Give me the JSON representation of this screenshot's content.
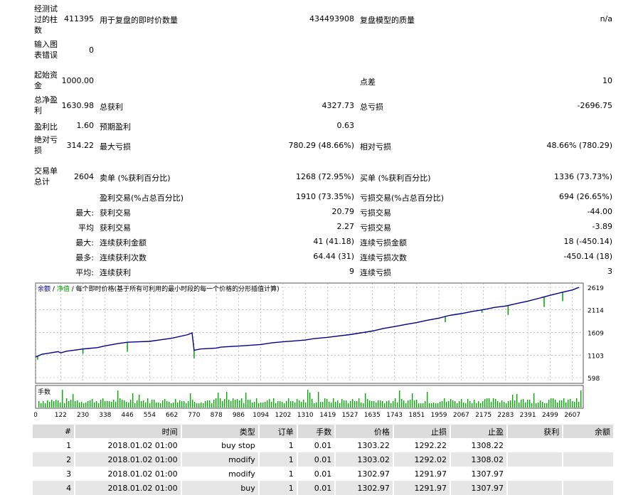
{
  "summary": {
    "bars_label": "经测试过的柱数",
    "bars_value": "411395",
    "ticks_label": "用于复盘的即时价数量",
    "ticks_value": "434493908",
    "quality_label": "复盘模型的质量",
    "quality_value": "n/a",
    "errors_label": "输入图表错误",
    "errors_value": "0",
    "deposit_label": "起始资金",
    "deposit_value": "1000.00",
    "spread_label": "点差",
    "spread_value": "10",
    "net_profit_label": "总净盈利",
    "net_profit_value": "1630.98",
    "gross_profit_label": "总获利",
    "gross_profit_value": "4327.73",
    "gross_loss_label": "总亏损",
    "gross_loss_value": "-2696.75",
    "profit_factor_label": "盈利比",
    "profit_factor_value": "1.60",
    "expected_payoff_label": "预期盈利",
    "expected_payoff_value": "0.63",
    "abs_drawdown_label": "绝对亏损",
    "abs_drawdown_value": "314.22",
    "max_drawdown_label": "最大亏损",
    "max_drawdown_value": "780.29 (48.66%)",
    "rel_drawdown_label": "相对亏损",
    "rel_drawdown_value": "48.66% (780.29)",
    "total_trades_label": "交易单总计",
    "total_trades_value": "2604",
    "short_label": "卖单 (%获利百分比)",
    "short_value": "1268 (72.95%)",
    "long_label": "买单 (%获利百分比)",
    "long_value": "1336 (73.73%)",
    "profit_trades_label": "盈利交易(%占总百分比)",
    "profit_trades_value": "1910 (73.35%)",
    "loss_trades_label": "亏损交易(%占总百分比)",
    "loss_trades_value": "694 (26.65%)",
    "largest_prefix": "最大:",
    "largest_profit_label": "获利交易",
    "largest_profit_value": "20.79",
    "largest_loss_label": "亏损交易",
    "largest_loss_value": "-44.00",
    "average_prefix": "平均",
    "avg_profit_label": "获利交易",
    "avg_profit_value": "2.27",
    "avg_loss_label": "亏损交易",
    "avg_loss_value": "-3.89",
    "max_prefix": "最大:",
    "max_cons_wins_label": "连续获利金额",
    "max_cons_wins_value": "41 (41.18)",
    "max_cons_losses_label": "连续亏损金额",
    "max_cons_losses_value": "18 (-450.14)",
    "most_prefix": "最多:",
    "max_cons_profit_label": "连续获利次数",
    "max_cons_profit_value": "64.44 (31)",
    "max_cons_loss_label": "连续亏损次数",
    "max_cons_loss_value": "-450.14 (18)",
    "avg_cons_prefix": "平均:",
    "avg_cons_wins_label": "连续获利",
    "avg_cons_wins_value": "9",
    "avg_cons_losses_label": "连续亏损",
    "avg_cons_losses_value": "3"
  },
  "chart_header": {
    "balance_label": "余额",
    "sep1": "/",
    "equity_label": "净值",
    "sep2": "/",
    "model_text": "每个即时价格(基于所有可利用的最小时段的每一个价格的分形插值计算)",
    "lots_label": "手数"
  },
  "chart_data": {
    "type": "line",
    "series": [
      {
        "name": "余额",
        "color": "#00008b",
        "x": [
          0,
          30,
          70,
          110,
          122,
          150,
          200,
          230,
          300,
          338,
          400,
          446,
          500,
          554,
          600,
          662,
          740,
          760,
          770,
          800,
          878,
          900,
          986,
          1000,
          1094,
          1150,
          1202,
          1260,
          1310,
          1350,
          1419,
          1470,
          1527,
          1580,
          1635,
          1690,
          1743,
          1800,
          1851,
          1900,
          1959,
          2010,
          2067,
          2120,
          2175,
          2230,
          2283,
          2340,
          2391,
          2450,
          2499,
          2560,
          2607,
          2640
        ],
        "y": [
          1060,
          1120,
          1150,
          1180,
          1150,
          1190,
          1220,
          1240,
          1270,
          1310,
          1360,
          1390,
          1400,
          1410,
          1440,
          1480,
          1560,
          1600,
          1210,
          1240,
          1260,
          1280,
          1305,
          1310,
          1340,
          1380,
          1400,
          1420,
          1440,
          1470,
          1500,
          1530,
          1560,
          1600,
          1640,
          1700,
          1740,
          1790,
          1830,
          1880,
          1930,
          1990,
          2030,
          2080,
          2120,
          2170,
          2200,
          2260,
          2310,
          2380,
          2440,
          2510,
          2560,
          2619
        ]
      },
      {
        "name": "净值",
        "color": "#00a000",
        "dips": [
          [
            10,
            1000
          ],
          [
            230,
            1130
          ],
          [
            446,
            1180
          ],
          [
            770,
            1030
          ],
          [
            1602,
            1590
          ],
          [
            1990,
            1840
          ],
          [
            2168,
            2050
          ],
          [
            2295,
            2000
          ],
          [
            2470,
            2180
          ],
          [
            2560,
            2310
          ]
        ]
      }
    ],
    "yticks": [
      "2619",
      "2114",
      "1609",
      "1103",
      "598"
    ],
    "xticks": [
      "0",
      "122",
      "230",
      "338",
      "446",
      "554",
      "662",
      "770",
      "878",
      "986",
      "1094",
      "1202",
      "1310",
      "1419",
      "1527",
      "1635",
      "1743",
      "1851",
      "1959",
      "2067",
      "2175",
      "2283",
      "2391",
      "2499",
      "2607"
    ],
    "ylim": [
      598,
      2619
    ],
    "xlim": [
      0,
      2660
    ],
    "grid": true
  },
  "table": {
    "headers": [
      "#",
      "时间",
      "类型",
      "订单",
      "手数",
      "价格",
      "止损",
      "止盈",
      "获利",
      "余额"
    ],
    "rows": [
      [
        "1",
        "2018.01.02 01:00",
        "buy stop",
        "1",
        "0.01",
        "1303.22",
        "1292.22",
        "1308.22",
        "",
        ""
      ],
      [
        "2",
        "2018.01.02 01:00",
        "modify",
        "1",
        "0.01",
        "1303.02",
        "1292.02",
        "1308.02",
        "",
        ""
      ],
      [
        "3",
        "2018.01.02 01:00",
        "modify",
        "1",
        "0.01",
        "1302.97",
        "1291.97",
        "1307.97",
        "",
        ""
      ],
      [
        "4",
        "2018.01.02 01:00",
        "buy",
        "1",
        "0.01",
        "1302.97",
        "1291.97",
        "1307.97",
        "",
        ""
      ]
    ]
  }
}
